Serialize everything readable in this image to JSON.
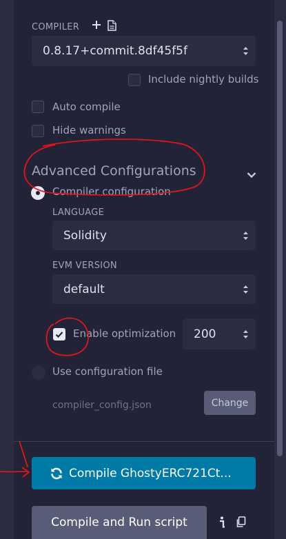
{
  "compiler": {
    "label": "COMPILER",
    "version": "0.8.17+commit.8df45f5f",
    "nightly_label": "Include nightly builds"
  },
  "options": {
    "auto_compile": "Auto compile",
    "hide_warnings": "Hide warnings"
  },
  "advanced": {
    "title": "Advanced Configurations",
    "compiler_config": "Compiler configuration",
    "language_label": "LANGUAGE",
    "language_value": "Solidity",
    "evm_label": "EVM VERSION",
    "evm_value": "default",
    "optimization_label": "Enable optimization",
    "optimization_runs": "200",
    "use_config_file": "Use configuration file",
    "config_file_name": "compiler_config.json",
    "change_label": "Change"
  },
  "actions": {
    "compile_label": "Compile GhostyERC721Ct...",
    "run_label": "Compile and Run script"
  },
  "colors": {
    "background": "#222336",
    "input_bg": "#2a2c3f",
    "accent": "#007aa6",
    "annotation": "#e0161b"
  },
  "states": {
    "include_nightly": false,
    "auto_compile": false,
    "hide_warnings": false,
    "compiler_configuration_selected": true,
    "enable_optimization": true,
    "use_configuration_file_selected": false
  }
}
